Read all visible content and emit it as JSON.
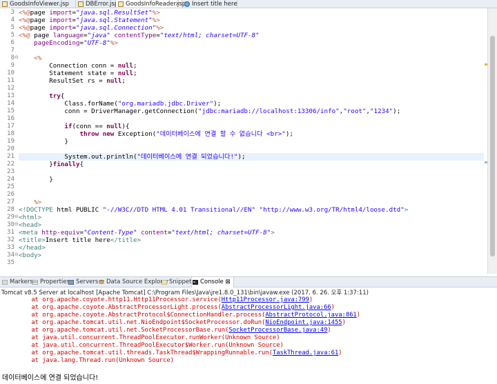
{
  "editor_tabs": [
    {
      "label": "GoodsInfoViewer.jsp",
      "active": false
    },
    {
      "label": "DBError.jsp",
      "active": false
    },
    {
      "label": "GoodsInfoReader.jsp",
      "active": true
    },
    {
      "label": "Insert title here",
      "active": false
    }
  ],
  "code_lines": [
    {
      "n": "3",
      "fold": "",
      "hl": false,
      "tokens": [
        [
          "jsp",
          "<%@"
        ],
        [
          "plain",
          "page "
        ],
        [
          "attr",
          "import"
        ],
        [
          "plain",
          "="
        ],
        [
          "aval",
          "\"java.sql.ResultSet\""
        ],
        [
          "jsp",
          "%>"
        ]
      ]
    },
    {
      "n": "4",
      "fold": "",
      "hl": false,
      "tokens": [
        [
          "jsp",
          "<%@"
        ],
        [
          "plain",
          "page "
        ],
        [
          "attr",
          "import"
        ],
        [
          "plain",
          "="
        ],
        [
          "aval",
          "\"java.sql.Statement\""
        ],
        [
          "jsp",
          "%>"
        ]
      ]
    },
    {
      "n": "5",
      "fold": "",
      "hl": false,
      "tokens": [
        [
          "jsp",
          "<%@"
        ],
        [
          "plain",
          "page "
        ],
        [
          "attr",
          "import"
        ],
        [
          "plain",
          "="
        ],
        [
          "aval",
          "\"java.sql.Connection\""
        ],
        [
          "jsp",
          "%>"
        ]
      ]
    },
    {
      "n": "5",
      "fold": "",
      "hl": false,
      "tokens": [
        [
          "jsp",
          "<%@"
        ],
        [
          "plain",
          " page "
        ],
        [
          "attr",
          "language"
        ],
        [
          "plain",
          "="
        ],
        [
          "aval",
          "\"java\""
        ],
        [
          "plain",
          " "
        ],
        [
          "attr",
          "contentType"
        ],
        [
          "plain",
          "="
        ],
        [
          "aval",
          "\"text/html; charset=UTF-8\""
        ]
      ]
    },
    {
      "n": "6",
      "fold": "",
      "hl": false,
      "tokens": [
        [
          "plain",
          "    "
        ],
        [
          "attr",
          "pageEncoding"
        ],
        [
          "plain",
          "="
        ],
        [
          "aval",
          "\"UTF-8\""
        ],
        [
          "jsp",
          "%>"
        ]
      ]
    },
    {
      "n": "7",
      "fold": "",
      "hl": false,
      "tokens": [
        [
          "plain",
          ""
        ]
      ]
    },
    {
      "n": "8",
      "fold": "⊖",
      "hl": false,
      "tokens": [
        [
          "plain",
          "    "
        ],
        [
          "jsp",
          "<%"
        ]
      ]
    },
    {
      "n": "9",
      "fold": "",
      "hl": false,
      "tokens": [
        [
          "plain",
          "        Connection conn = "
        ],
        [
          "kw",
          "null"
        ],
        [
          "plain",
          ";"
        ]
      ]
    },
    {
      "n": "10",
      "fold": "",
      "hl": false,
      "tokens": [
        [
          "plain",
          "        Statement state = "
        ],
        [
          "kw",
          "null"
        ],
        [
          "plain",
          ";"
        ]
      ]
    },
    {
      "n": "11",
      "fold": "",
      "hl": false,
      "tokens": [
        [
          "plain",
          "        ResultSet rs = "
        ],
        [
          "kw",
          "null"
        ],
        [
          "plain",
          ";"
        ]
      ]
    },
    {
      "n": "12",
      "fold": "",
      "hl": false,
      "tokens": [
        [
          "plain",
          ""
        ]
      ]
    },
    {
      "n": "13",
      "fold": "",
      "hl": false,
      "tokens": [
        [
          "plain",
          "        "
        ],
        [
          "kw",
          "try"
        ],
        [
          "plain",
          "{"
        ]
      ]
    },
    {
      "n": "14",
      "fold": "",
      "hl": false,
      "tokens": [
        [
          "plain",
          "            Class."
        ],
        [
          "plain",
          "forName("
        ],
        [
          "str",
          "\"org.mariadb.jdbc.Driver\""
        ],
        [
          "plain",
          ");"
        ]
      ]
    },
    {
      "n": "15",
      "fold": "",
      "hl": false,
      "tokens": [
        [
          "plain",
          "            conn = DriverManager."
        ],
        [
          "plain",
          "getConnection("
        ],
        [
          "str",
          "\"jdbc:mariadb://localhost:13306/info\""
        ],
        [
          "plain",
          ","
        ],
        [
          "str",
          "\"root\""
        ],
        [
          "plain",
          ","
        ],
        [
          "str",
          "\"1234\""
        ],
        [
          "plain",
          ");"
        ]
      ]
    },
    {
      "n": "16",
      "fold": "",
      "hl": false,
      "tokens": [
        [
          "plain",
          ""
        ]
      ]
    },
    {
      "n": "17",
      "fold": "",
      "hl": false,
      "tokens": [
        [
          "plain",
          "            "
        ],
        [
          "kw",
          "if"
        ],
        [
          "plain",
          "(conn == "
        ],
        [
          "kw",
          "null"
        ],
        [
          "plain",
          "){"
        ]
      ]
    },
    {
      "n": "18",
      "fold": "",
      "hl": false,
      "tokens": [
        [
          "plain",
          "                "
        ],
        [
          "kw",
          "throw new"
        ],
        [
          "plain",
          " Exception("
        ],
        [
          "str",
          "\"데이터베이스에 연결 할 수 없습니다 <br>\""
        ],
        [
          "plain",
          ");"
        ]
      ]
    },
    {
      "n": "19",
      "fold": "",
      "hl": false,
      "tokens": [
        [
          "plain",
          "            }"
        ]
      ]
    },
    {
      "n": "20",
      "fold": "",
      "hl": false,
      "tokens": [
        [
          "plain",
          ""
        ]
      ]
    },
    {
      "n": "21",
      "fold": "",
      "hl": true,
      "tokens": [
        [
          "plain",
          "            System."
        ],
        [
          "plain",
          "out"
        ],
        [
          "plain",
          ".println("
        ],
        [
          "str",
          "\"데이터베이스에 연결 되었습니다!\""
        ],
        [
          "plain",
          ");"
        ]
      ]
    },
    {
      "n": "22",
      "fold": "",
      "hl": false,
      "tokens": [
        [
          "plain",
          "        }"
        ],
        [
          "kw",
          "finally"
        ],
        [
          "plain",
          "{"
        ]
      ]
    },
    {
      "n": "23",
      "fold": "",
      "hl": false,
      "tokens": [
        [
          "plain",
          ""
        ]
      ]
    },
    {
      "n": "24",
      "fold": "",
      "hl": false,
      "tokens": [
        [
          "plain",
          "        }"
        ]
      ]
    },
    {
      "n": "25",
      "fold": "",
      "hl": false,
      "tokens": [
        [
          "plain",
          ""
        ]
      ]
    },
    {
      "n": "26",
      "fold": "",
      "hl": false,
      "tokens": [
        [
          "plain",
          ""
        ]
      ]
    },
    {
      "n": "27",
      "fold": "",
      "hl": false,
      "tokens": [
        [
          "plain",
          "    "
        ],
        [
          "jsp",
          "%>"
        ]
      ]
    },
    {
      "n": "28",
      "fold": "",
      "hl": false,
      "tokens": [
        [
          "tag",
          "<!DOCTYPE "
        ],
        [
          "plain",
          "html PUBLIC "
        ],
        [
          "str",
          "\"-//W3C//DTD HTML 4.01 Transitional//EN\""
        ],
        [
          "plain",
          " "
        ],
        [
          "str",
          "\"http://www.w3.org/TR/html4/loose.dtd\""
        ],
        [
          "tag",
          ">"
        ]
      ]
    },
    {
      "n": "29",
      "fold": "⊖",
      "hl": false,
      "tokens": [
        [
          "tag",
          "<html>"
        ]
      ]
    },
    {
      "n": "30",
      "fold": "⊖",
      "hl": false,
      "tokens": [
        [
          "tag",
          "<head>"
        ]
      ]
    },
    {
      "n": "31",
      "fold": "",
      "hl": false,
      "tokens": [
        [
          "tag",
          "<meta "
        ],
        [
          "attr",
          "http-equiv"
        ],
        [
          "plain",
          "="
        ],
        [
          "aval",
          "\"Content-Type\""
        ],
        [
          "plain",
          " "
        ],
        [
          "attr",
          "content"
        ],
        [
          "plain",
          "="
        ],
        [
          "aval",
          "\"text/html; charset=UTF-8\""
        ],
        [
          "tag",
          ">"
        ]
      ]
    },
    {
      "n": "32",
      "fold": "",
      "hl": false,
      "tokens": [
        [
          "tag",
          "<title>"
        ],
        [
          "plain",
          "Insert title here"
        ],
        [
          "tag",
          "</title>"
        ]
      ]
    },
    {
      "n": "33",
      "fold": "",
      "hl": false,
      "tokens": [
        [
          "tag",
          "</head>"
        ]
      ]
    },
    {
      "n": "34",
      "fold": "⊖",
      "hl": false,
      "tokens": [
        [
          "tag",
          "<body>"
        ]
      ]
    },
    {
      "n": "35",
      "fold": "",
      "hl": false,
      "tokens": [
        [
          "plain",
          ""
        ]
      ]
    }
  ],
  "view_tabs": [
    {
      "label": "Markers",
      "active": false
    },
    {
      "label": "Properties",
      "active": false
    },
    {
      "label": "Servers",
      "active": false
    },
    {
      "label": "Data Source Explorer",
      "active": false
    },
    {
      "label": "Snippets",
      "active": false
    },
    {
      "label": "Console ⊠",
      "active": true
    }
  ],
  "console": {
    "header": "Tomcat v8.5 Server at localhost [Apache Tomcat] C:\\Program Files\\Java\\jre1.8.0_131\\bin\\javaw.exe (2017. 6. 26. 오후 1:37:11)",
    "lines": [
      {
        "text": "        at org.apache.coyote.http11.Http11Processor.service(",
        "link": "Http11Processor.java:799",
        "tail": ")"
      },
      {
        "text": "        at org.apache.coyote.AbstractProcessorLight.process(",
        "link": "AbstractProcessorLight.java:66",
        "tail": ")"
      },
      {
        "text": "        at org.apache.coyote.AbstractProtocol$ConnectionHandler.process(",
        "link": "AbstractProtocol.java:861",
        "tail": ")"
      },
      {
        "text": "        at org.apache.tomcat.util.net.NioEndpoint$SocketProcessor.doRun(",
        "link": "NioEndpoint.java:1455",
        "tail": ")"
      },
      {
        "text": "        at org.apache.tomcat.util.net.SocketProcessorBase.run(",
        "link": "SocketProcessorBase.java:49",
        "tail": ")"
      },
      {
        "text": "        at java.util.concurrent.ThreadPoolExecutor.runWorker(Unknown Source)",
        "link": "",
        "tail": ""
      },
      {
        "text": "        at java.util.concurrent.ThreadPoolExecutor$Worker.run(Unknown Source)",
        "link": "",
        "tail": ""
      },
      {
        "text": "        at org.apache.tomcat.util.threads.TaskThread$WrappingRunnable.run(",
        "link": "TaskThread.java:61",
        "tail": ")"
      },
      {
        "text": "        at java.lang.Thread.run(Unknown Source)",
        "link": "",
        "tail": ""
      }
    ],
    "output": "데이터베이스에 연결 되었습니다!"
  }
}
